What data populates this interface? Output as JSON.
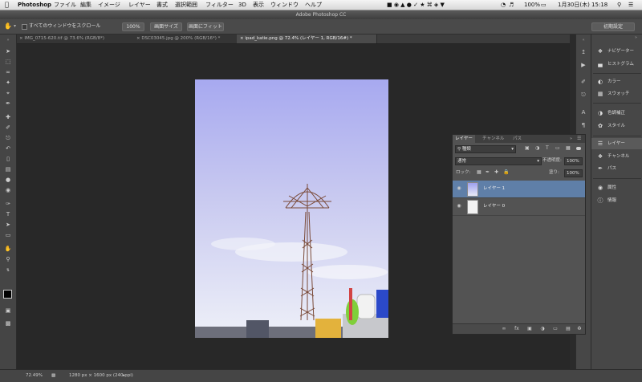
{
  "menubar": {
    "apple_icon": "apple-icon",
    "items": [
      "Photoshop",
      "ファイル",
      "編集",
      "イメージ",
      "レイヤー",
      "書式",
      "選択範囲",
      "フィルター",
      "3D",
      "表示",
      "ウィンドウ",
      "ヘルプ"
    ],
    "battery": "100%",
    "datetime": "1月30日(木) 15:18"
  },
  "titlebar": {
    "title": "Adobe Photoshop CC"
  },
  "options": {
    "scroll_all_label": "すべてのウィンドウをスクロール",
    "btn_100": "100%",
    "btn_actual": "画面サイズ",
    "btn_fit": "画面にフィット",
    "workspace": "初期設定"
  },
  "tabs": [
    {
      "label": "IMG_0715-620.tif @ 73.6% (RGB/8*)",
      "active": false
    },
    {
      "label": "DSC03045.jpg @ 200% (RGB/16*) *",
      "active": false
    },
    {
      "label": "ipad_katie.png @ 72.4% (レイヤー 1, RGB/16#) *",
      "active": true
    }
  ],
  "status": {
    "zoom": "72.49%",
    "doc_size": "1280 px × 1600 px (240 ppi)"
  },
  "panels": {
    "items": [
      {
        "icon": "navigator-icon",
        "label": "ナビゲーター"
      },
      {
        "icon": "histogram-icon",
        "label": "ヒストグラム"
      },
      {
        "icon": "color-icon",
        "label": "カラー"
      },
      {
        "icon": "swatches-icon",
        "label": "スウォッチ"
      },
      {
        "icon": "adjustments-icon",
        "label": "色調補正"
      },
      {
        "icon": "styles-icon",
        "label": "スタイル"
      },
      {
        "icon": "layers-icon",
        "label": "レイヤー"
      },
      {
        "icon": "channels-icon",
        "label": "チャンネル"
      },
      {
        "icon": "paths-icon",
        "label": "パス"
      },
      {
        "icon": "color-icon",
        "label": "属性"
      },
      {
        "icon": "info-icon",
        "label": "情報"
      }
    ]
  },
  "layers_panel": {
    "tabs": [
      "レイヤー",
      "チャンネル",
      "パス"
    ],
    "filter_kind": "種類",
    "blend_mode": "通常",
    "opacity_label": "不透明度:",
    "opacity": "100%",
    "lock_label": "ロック:",
    "fill_label": "塗り:",
    "fill": "100%",
    "layers": [
      {
        "name": "レイヤー 1",
        "selected": true
      },
      {
        "name": "レイヤー 0",
        "selected": false
      }
    ]
  },
  "colors": {
    "accent_selection": "#5f7fa8",
    "sky_top": "#a7a9f0",
    "sky_bottom": "#eef0f8"
  }
}
